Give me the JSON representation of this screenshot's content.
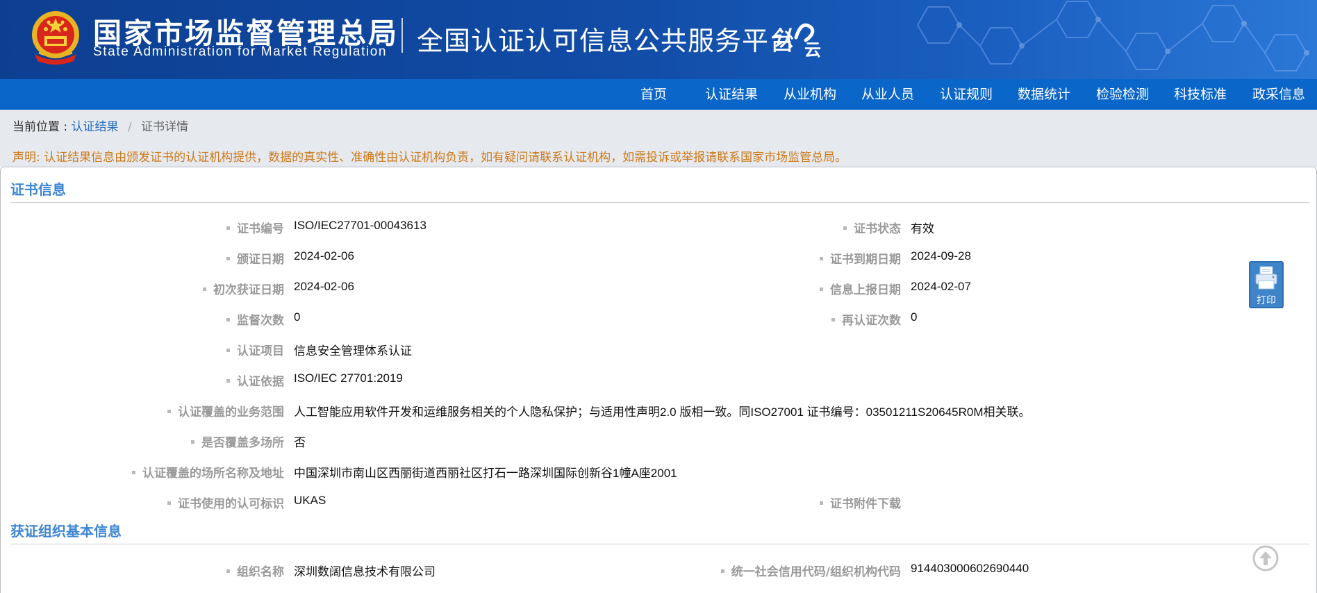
{
  "header": {
    "agency_cn": "国家市场监督管理总局",
    "agency_en": "State Administration  for  Market Regulation",
    "platform_title": "全国认证认可信息公共服务平台",
    "emblem_icon": "national-emblem-icon",
    "brand_logo_icon": "renzheng-yun-logo-icon",
    "brand_logo_text": "认云"
  },
  "nav": {
    "items": [
      {
        "label": "首页"
      },
      {
        "label": "认证结果"
      },
      {
        "label": "从业机构"
      },
      {
        "label": "从业人员"
      },
      {
        "label": "认证规则"
      },
      {
        "label": "数据统计"
      },
      {
        "label": "检验检测"
      },
      {
        "label": "科技标准"
      },
      {
        "label": "政采信息"
      }
    ]
  },
  "breadcrumb": {
    "label": "当前位置 :",
    "link": "认证结果",
    "separator": "/",
    "current": "证书详情"
  },
  "notice": "声明: 认证结果信息由颁发证书的认证机构提供，数据的真实性、准确性由认证机构负责，如有疑问请联系认证机构，如需投诉或举报请联系国家市场监管总局。",
  "cert_section": {
    "title": "证书信息",
    "cert_no_label": "证书编号",
    "cert_no": "ISO/IEC27701-00043613",
    "status_label": "证书状态",
    "status": "有效",
    "issue_date_label": "颁证日期",
    "issue_date": "2024-02-06",
    "expiry_label": "证书到期日期",
    "expiry": "2024-09-28",
    "first_date_label": "初次获证日期",
    "first_date": "2024-02-06",
    "report_date_label": "信息上报日期",
    "report_date": "2024-02-07",
    "supervision_label": "监督次数",
    "supervision": "0",
    "recert_label": "再认证次数",
    "recert": "0",
    "project_label": "认证项目",
    "project": "信息安全管理体系认证",
    "basis_label": "认证依据",
    "basis": "ISO/IEC 27701:2019",
    "scope_label": "认证覆盖的业务范围",
    "scope": "人工智能应用软件开发和运维服务相关的个人隐私保护；与适用性声明2.0 版相一致。同ISO27001 证书编号：03501211S20645R0M相关联。",
    "multisite_label": "是否覆盖多场所",
    "multisite": "否",
    "site_label": "认证覆盖的场所名称及地址",
    "site": "中国深圳市南山区西丽街道西丽社区打石一路深圳国际创新谷1幢A座2001",
    "accred_label": "证书使用的认可标识",
    "accred": "UKAS",
    "attachment_label": "证书附件下载"
  },
  "org_section": {
    "title": "获证组织基本信息",
    "org_name_label": "组织名称",
    "org_name": "深圳数阔信息技术有限公司",
    "credit_code_label": "统一社会信用代码/组织机构代码",
    "credit_code": "914403000602690440"
  },
  "tools": {
    "print_label": "打印",
    "print_icon": "printer-icon",
    "top_icon": "arrow-up-circle-icon"
  },
  "colors": {
    "banner_blue": "#114ba5",
    "nav_blue": "#0b66c9",
    "section_title_blue": "#3d86d4",
    "notice_orange": "#cc7a1a",
    "label_gray": "#9a9a9a"
  }
}
